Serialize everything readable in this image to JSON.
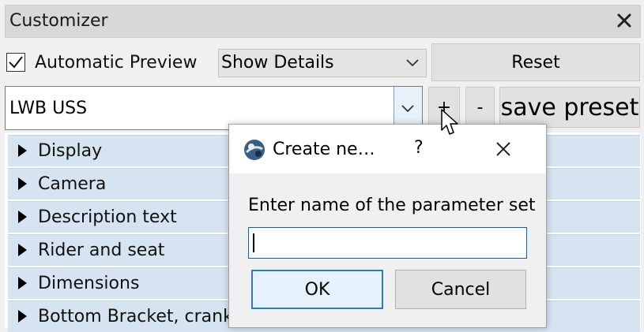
{
  "window": {
    "title": "Customizer"
  },
  "controls": {
    "automatic_preview_label": "Automatic Preview",
    "automatic_preview_checked": true,
    "details_select_value": "Show Details",
    "reset_label": "Reset"
  },
  "preset": {
    "value": "LWB USS",
    "add_label": "+",
    "remove_label": "-",
    "save_label": "save preset"
  },
  "tree": {
    "items": [
      {
        "label": "Display"
      },
      {
        "label": "Camera"
      },
      {
        "label": "Description text"
      },
      {
        "label": "Rider and seat"
      },
      {
        "label": "Dimensions"
      },
      {
        "label": "Bottom Bracket, cranks"
      }
    ]
  },
  "dialog": {
    "title": "Create ne…",
    "help": "?",
    "prompt": "Enter name of the parameter set",
    "input_value": "",
    "ok_label": "OK",
    "cancel_label": "Cancel"
  },
  "icons": {
    "close": "close-icon",
    "chevron": "chevron-down-icon",
    "tree_arrow": "caret-right-icon",
    "app": "openscad-icon",
    "cursor": "mouse-cursor-icon"
  },
  "colors": {
    "tree_row_bg": "#d6e4f1",
    "focus_blue": "#0a62b6",
    "button_bg": "#e1e1e1"
  }
}
